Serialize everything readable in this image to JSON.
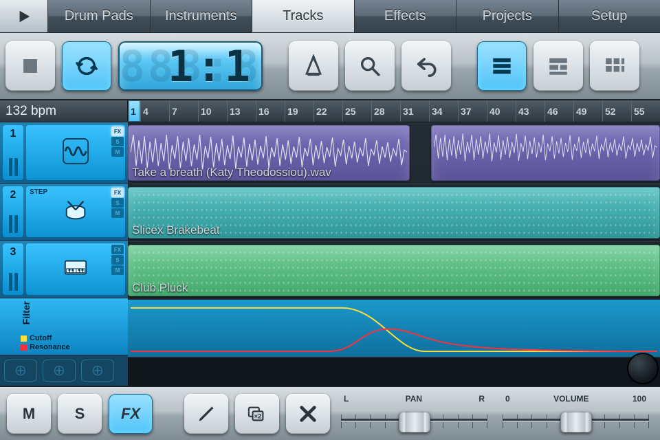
{
  "tabs": {
    "items": [
      "Drum Pads",
      "Instruments",
      "Tracks",
      "Effects",
      "Projects",
      "Setup"
    ],
    "active_index": 2
  },
  "transport": {
    "position_display": "1:1",
    "tempo_label": "132 bpm"
  },
  "timeline": {
    "bars": [
      1,
      4,
      7,
      10,
      13,
      16,
      19,
      22,
      25,
      28,
      31,
      34,
      37,
      40,
      43,
      46,
      49,
      52,
      55
    ]
  },
  "tracks": [
    {
      "num": "1",
      "kind": "audio",
      "clip_label": "Take a breath (Katy Theodossiou).wav",
      "flags": [
        "FX",
        "S",
        "M"
      ],
      "lit": [
        true,
        false,
        false
      ]
    },
    {
      "num": "2",
      "kind": "step",
      "clip_label": "Slicex Brakebeat",
      "step_label": "STEP",
      "flags": [
        "FX",
        "S",
        "M"
      ],
      "lit": [
        true,
        false,
        false
      ]
    },
    {
      "num": "3",
      "kind": "keys",
      "clip_label": "Club Pluck",
      "flags": [
        "FX",
        "S",
        "M"
      ],
      "lit": [
        false,
        false,
        false
      ]
    }
  ],
  "automation": {
    "title": "Filter",
    "params": [
      {
        "name": "Cutoff",
        "color": "#ffe03a"
      },
      {
        "name": "Resonance",
        "color": "#ff2f3a"
      }
    ]
  },
  "bottom": {
    "mute_label": "M",
    "solo_label": "S",
    "fx_label": "FX",
    "x2_label": "×2",
    "pan": {
      "left": "L",
      "center": "PAN",
      "right": "R",
      "value": 0.5
    },
    "vol": {
      "min": "0",
      "label": "VOLUME",
      "max": "100",
      "value": 0.5
    }
  }
}
